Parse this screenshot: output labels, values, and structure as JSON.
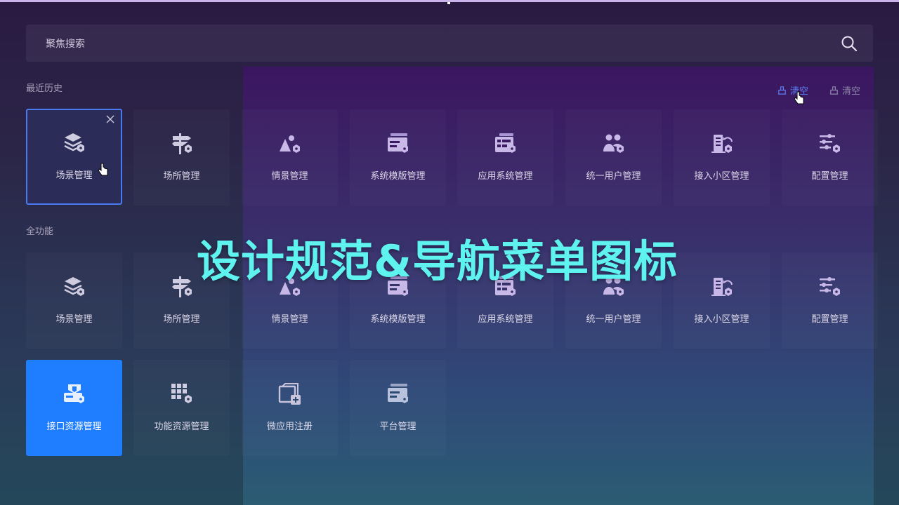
{
  "search": {
    "placeholder": "聚焦搜索",
    "icon": "search-icon"
  },
  "recent": {
    "title": "最近历史",
    "clear_label": "清空",
    "clear_label_2": "清空",
    "items": [
      {
        "label": "场景管理",
        "icon": "layers-hex-icon"
      },
      {
        "label": "场所管理",
        "icon": "signpost-icon"
      },
      {
        "label": "情景管理",
        "icon": "scene-shapes-icon"
      },
      {
        "label": "系统模版管理",
        "icon": "template-card-icon"
      },
      {
        "label": "应用系统管理",
        "icon": "app-system-icon"
      },
      {
        "label": "统一用户管理",
        "icon": "users-icon"
      },
      {
        "label": "接入小区管理",
        "icon": "building-access-icon"
      },
      {
        "label": "配置管理",
        "icon": "sliders-icon"
      }
    ]
  },
  "all": {
    "title": "全功能",
    "items": [
      {
        "label": "场景管理",
        "icon": "layers-hex-icon"
      },
      {
        "label": "场所管理",
        "icon": "signpost-icon"
      },
      {
        "label": "情景管理",
        "icon": "scene-shapes-icon"
      },
      {
        "label": "系统模版管理",
        "icon": "template-card-icon"
      },
      {
        "label": "应用系统管理",
        "icon": "app-system-icon"
      },
      {
        "label": "统一用户管理",
        "icon": "users-icon"
      },
      {
        "label": "接入小区管理",
        "icon": "building-access-icon"
      },
      {
        "label": "配置管理",
        "icon": "sliders-icon"
      },
      {
        "label": "接口资源管理",
        "icon": "api-resource-icon"
      },
      {
        "label": "功能资源管理",
        "icon": "grid-resource-icon"
      },
      {
        "label": "微应用注册",
        "icon": "micro-app-add-icon"
      },
      {
        "label": "平台管理",
        "icon": "platform-card-icon"
      }
    ]
  },
  "overlay": {
    "title": "设计规范&导航菜单图标"
  },
  "colors": {
    "accent": "#1f7dff",
    "selected_border": "#4a7af0",
    "overlay_text": "#5ff3f0"
  }
}
